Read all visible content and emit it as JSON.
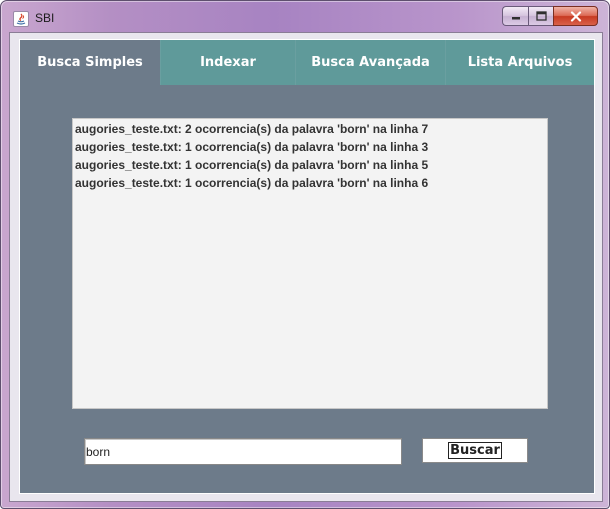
{
  "window": {
    "title": "SBI"
  },
  "tabs": [
    {
      "label": "Busca Simples",
      "selected": true
    },
    {
      "label": "Indexar",
      "selected": false
    },
    {
      "label": "Busca Avançada",
      "selected": false
    },
    {
      "label": "Lista Arquivos",
      "selected": false
    }
  ],
  "results": [
    "augories_teste.txt: 2 ocorrencia(s) da palavra 'born' na linha 7",
    "augories_teste.txt: 1 ocorrencia(s) da palavra 'born' na linha 3",
    "augories_teste.txt: 1 ocorrencia(s) da palavra 'born' na linha 5",
    "augories_teste.txt: 1 ocorrencia(s) da palavra 'born' na linha 6"
  ],
  "search": {
    "value": "born",
    "button_label": "Buscar"
  },
  "colors": {
    "tab_active": "#6d7b8a",
    "tab_inactive": "#5f9a9a",
    "content_bg": "#6d7b8a"
  }
}
